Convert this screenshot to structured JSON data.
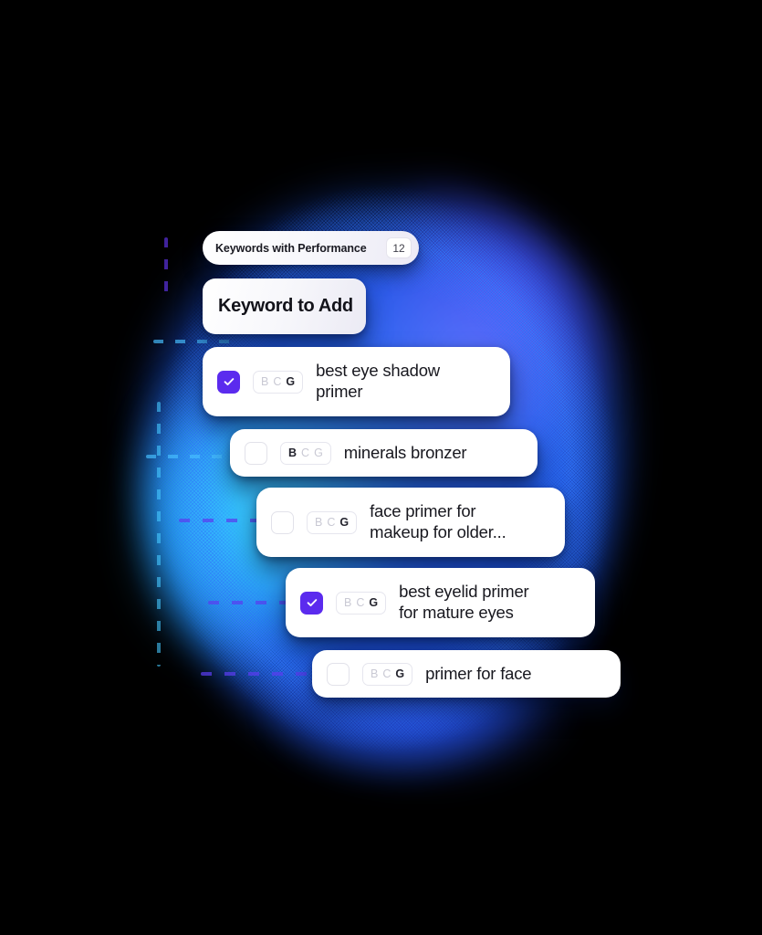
{
  "header": {
    "pill_label": "Keywords with Performance",
    "count": "12",
    "add_label": "Keyword to Add"
  },
  "colors": {
    "checkbox_checked": "#5B2BEE",
    "card_background": "#ffffff",
    "badge_active_text": "#24242e",
    "badge_inactive_text": "#c9c9d4",
    "canvas_background": "#000000",
    "glow_blue": "#2563EB",
    "glow_cyan": "#21A2FC",
    "glow_indigo": "#3A48F0"
  },
  "keyword_rows": [
    {
      "text": "best eye shadow\nprimer",
      "checked": true,
      "badges": [
        {
          "letter": "B",
          "active": false
        },
        {
          "letter": "C",
          "active": false
        },
        {
          "letter": "G",
          "active": true
        }
      ]
    },
    {
      "text": "minerals bronzer",
      "checked": false,
      "badges": [
        {
          "letter": "B",
          "active": true
        },
        {
          "letter": "C",
          "active": false
        },
        {
          "letter": "G",
          "active": false
        }
      ]
    },
    {
      "text": "face primer for\nmakeup for older...",
      "checked": false,
      "badges": [
        {
          "letter": "B",
          "active": false
        },
        {
          "letter": "C",
          "active": false
        },
        {
          "letter": "G",
          "active": true
        }
      ]
    },
    {
      "text": "best eyelid primer\nfor mature eyes",
      "checked": true,
      "badges": [
        {
          "letter": "B",
          "active": false
        },
        {
          "letter": "C",
          "active": false
        },
        {
          "letter": "G",
          "active": true
        }
      ]
    },
    {
      "text": "primer for face",
      "checked": false,
      "badges": [
        {
          "letter": "B",
          "active": false
        },
        {
          "letter": "C",
          "active": false
        },
        {
          "letter": "G",
          "active": true
        }
      ]
    }
  ]
}
